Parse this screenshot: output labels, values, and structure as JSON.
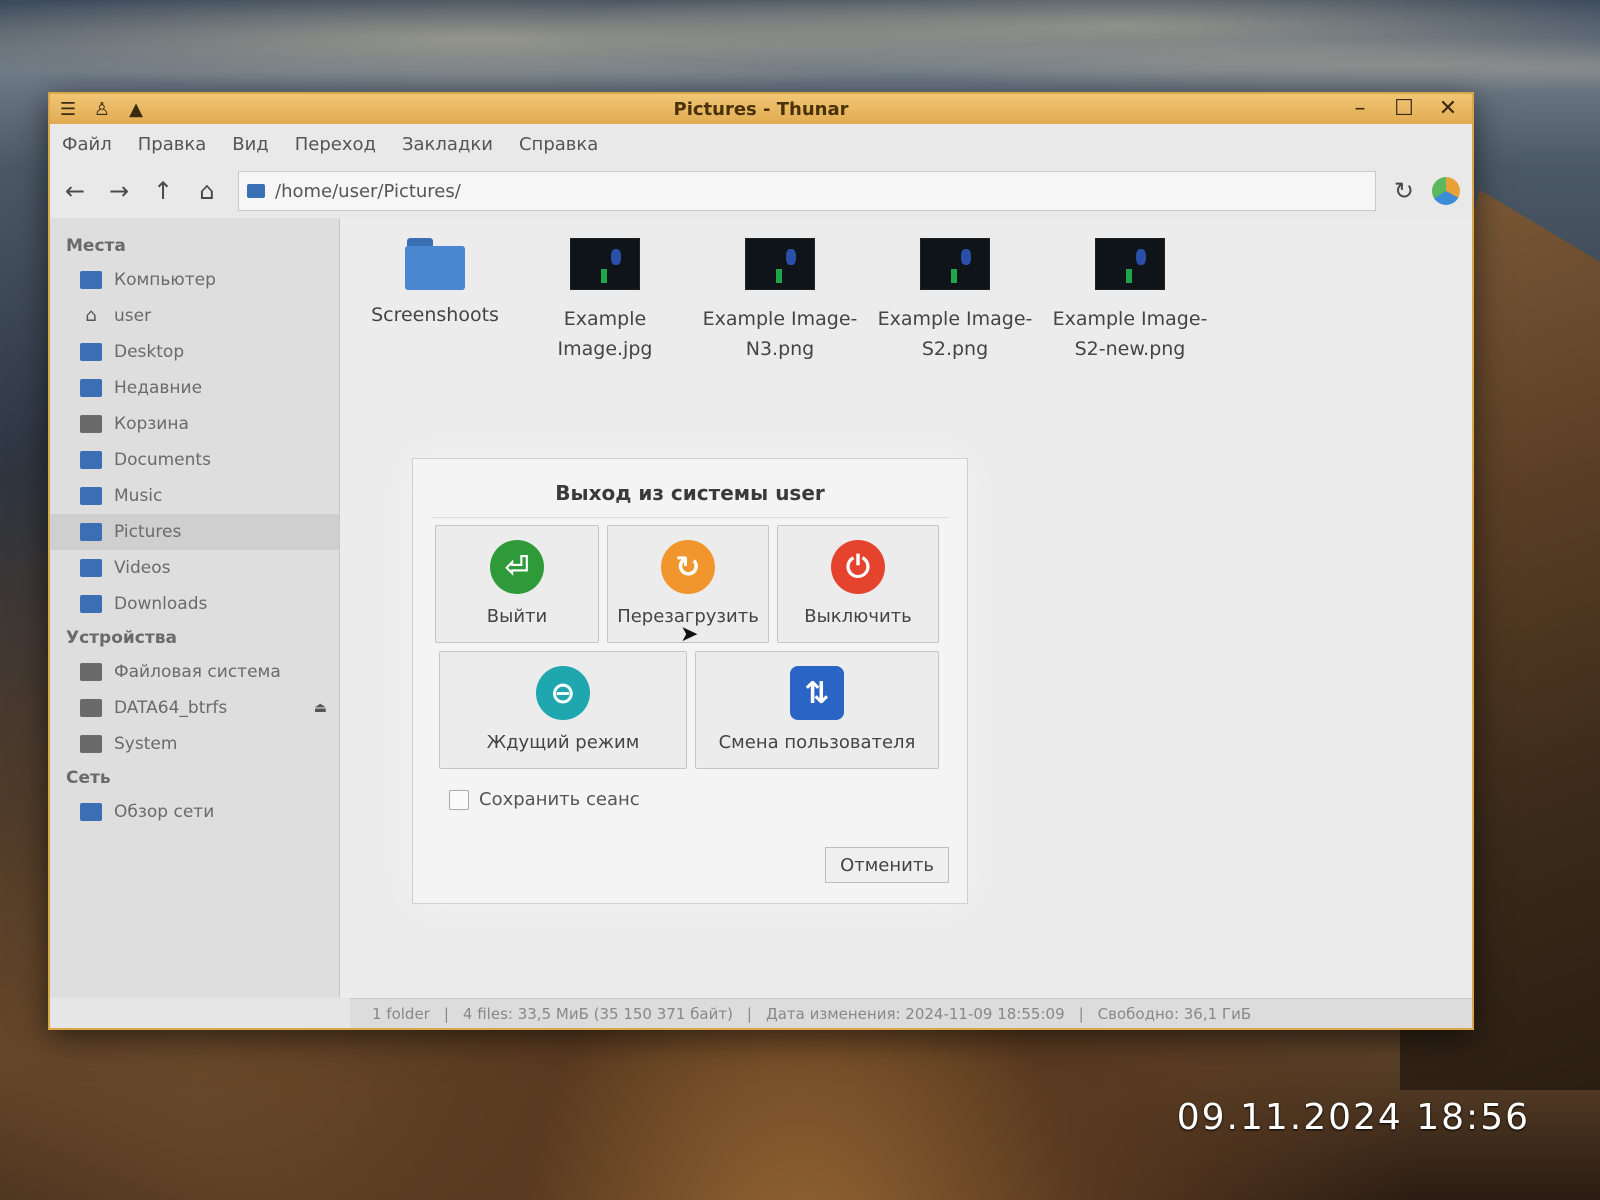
{
  "window": {
    "title": "Pictures - Thunar"
  },
  "menubar": [
    "Файл",
    "Правка",
    "Вид",
    "Переход",
    "Закладки",
    "Справка"
  ],
  "location": {
    "path": "/home/user/Pictures/"
  },
  "sidebar": {
    "places_header": "Места",
    "places": [
      "Компьютер",
      "user",
      "Desktop",
      "Недавние",
      "Корзина",
      "Documents",
      "Music",
      "Pictures",
      "Videos",
      "Downloads"
    ],
    "devices_header": "Устройства",
    "devices": [
      "Файловая система",
      "DATA64_btrfs",
      "System"
    ],
    "network_header": "Сеть",
    "network": [
      "Обзор сети"
    ]
  },
  "files": [
    {
      "name": "Screenshoots",
      "type": "folder"
    },
    {
      "name": "Example Image.jpg",
      "type": "image"
    },
    {
      "name": "Example Image-N3.png",
      "type": "image"
    },
    {
      "name": "Example Image-S2.png",
      "type": "image"
    },
    {
      "name": "Example Image-S2-new.png",
      "type": "image"
    }
  ],
  "statusbar": {
    "folders": "1 folder",
    "files": "4 files: 33,5 МиБ (35 150 371 байт)",
    "modified": "Дата изменения: 2024-11-09 18:55:09",
    "free": "Свободно: 36,1 ГиБ"
  },
  "dialog": {
    "title": "Выход из системы user",
    "logout": "Выйти",
    "reboot": "Перезагрузить",
    "shutdown": "Выключить",
    "suspend": "Ждущий режим",
    "switch_user": "Смена пользователя",
    "save_session": "Сохранить сеанс",
    "cancel": "Отменить"
  },
  "datestamp": "09.11.2024 18:56",
  "colors": {
    "titlebar": "#e2ab52",
    "logout": "#2f9a3a",
    "reboot": "#f0962d",
    "shutdown": "#e5432e",
    "suspend": "#1fa7b0",
    "switch_user": "#2a64c4"
  }
}
